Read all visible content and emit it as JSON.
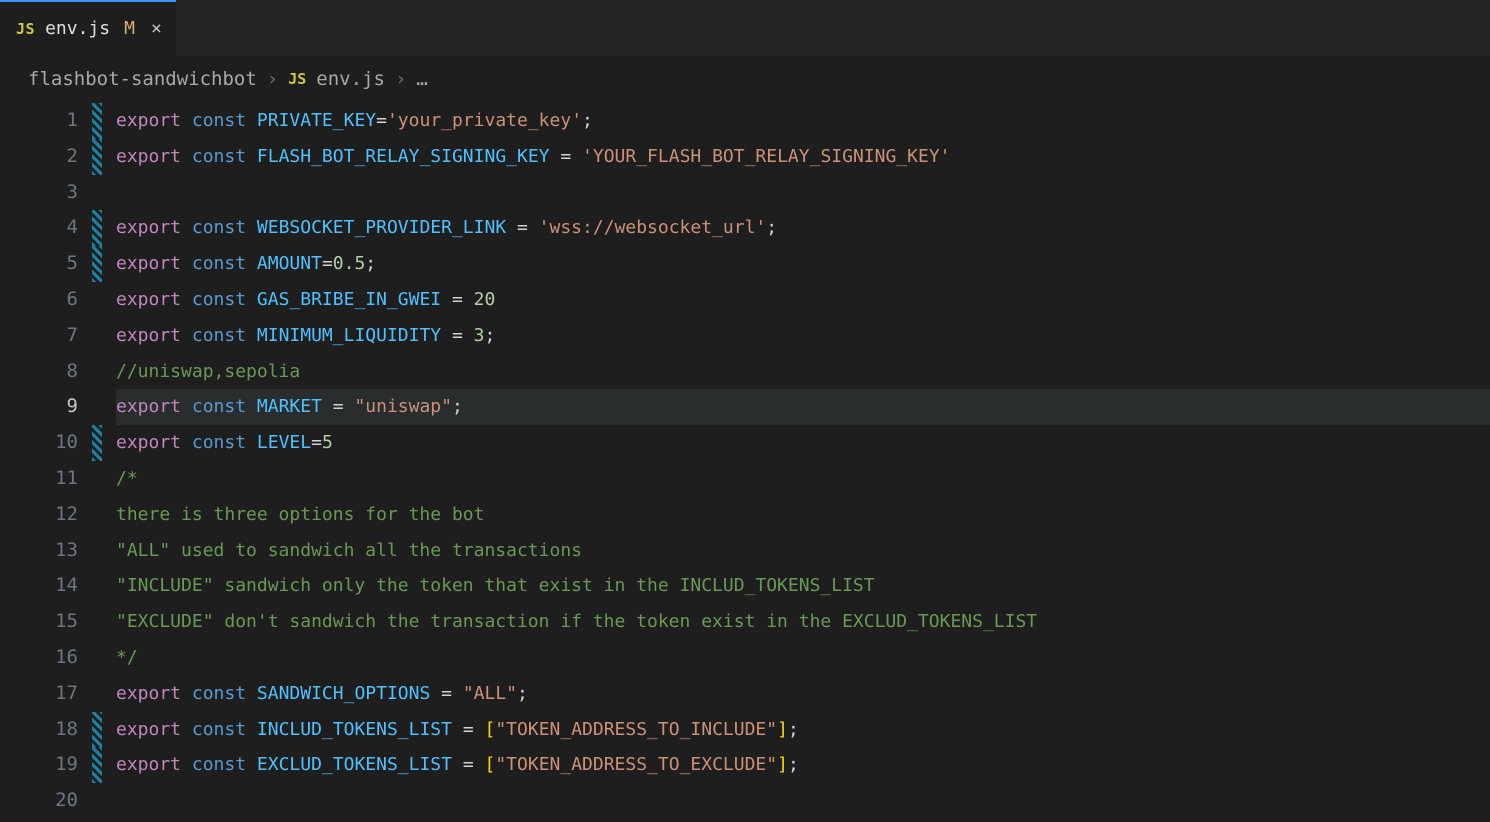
{
  "tab": {
    "icon_label": "JS",
    "filename": "env.js",
    "modified_marker": "M",
    "close_glyph": "×"
  },
  "breadcrumbs": {
    "folder": "flashbot-sandwichbot",
    "icon_label": "JS",
    "file": "env.js",
    "rest": "…"
  },
  "editor": {
    "current_line": 9,
    "lines": [
      {
        "n": 1,
        "modified": true,
        "tokens": [
          [
            "kw",
            "export"
          ],
          [
            "pn",
            " "
          ],
          [
            "dec",
            "const"
          ],
          [
            "pn",
            " "
          ],
          [
            "id",
            "PRIVATE_KEY"
          ],
          [
            "pn",
            "="
          ],
          [
            "str",
            "'your_private_key'"
          ],
          [
            "pn",
            ";"
          ]
        ]
      },
      {
        "n": 2,
        "modified": true,
        "tokens": [
          [
            "kw",
            "export"
          ],
          [
            "pn",
            " "
          ],
          [
            "dec",
            "const"
          ],
          [
            "pn",
            " "
          ],
          [
            "id",
            "FLASH_BOT_RELAY_SIGNING_KEY"
          ],
          [
            "pn",
            " = "
          ],
          [
            "str",
            "'YOUR_FLASH_BOT_RELAY_SIGNING_KEY'"
          ]
        ]
      },
      {
        "n": 3,
        "modified": false,
        "tokens": [
          [
            "pn",
            ""
          ]
        ]
      },
      {
        "n": 4,
        "modified": true,
        "tokens": [
          [
            "kw",
            "export"
          ],
          [
            "pn",
            " "
          ],
          [
            "dec",
            "const"
          ],
          [
            "pn",
            " "
          ],
          [
            "id",
            "WEBSOCKET_PROVIDER_LINK"
          ],
          [
            "pn",
            " = "
          ],
          [
            "str",
            "'wss://websocket_url'"
          ],
          [
            "pn",
            ";"
          ]
        ]
      },
      {
        "n": 5,
        "modified": true,
        "tokens": [
          [
            "kw",
            "export"
          ],
          [
            "pn",
            " "
          ],
          [
            "dec",
            "const"
          ],
          [
            "pn",
            " "
          ],
          [
            "id",
            "AMOUNT"
          ],
          [
            "pn",
            "="
          ],
          [
            "num",
            "0.5"
          ],
          [
            "pn",
            ";"
          ]
        ]
      },
      {
        "n": 6,
        "modified": false,
        "tokens": [
          [
            "kw",
            "export"
          ],
          [
            "pn",
            " "
          ],
          [
            "dec",
            "const"
          ],
          [
            "pn",
            " "
          ],
          [
            "id",
            "GAS_BRIBE_IN_GWEI"
          ],
          [
            "pn",
            " = "
          ],
          [
            "num",
            "20"
          ]
        ]
      },
      {
        "n": 7,
        "modified": false,
        "tokens": [
          [
            "kw",
            "export"
          ],
          [
            "pn",
            " "
          ],
          [
            "dec",
            "const"
          ],
          [
            "pn",
            " "
          ],
          [
            "id",
            "MINIMUM_LIQUIDITY"
          ],
          [
            "pn",
            " = "
          ],
          [
            "num",
            "3"
          ],
          [
            "pn",
            ";"
          ]
        ]
      },
      {
        "n": 8,
        "modified": false,
        "tokens": [
          [
            "cmt",
            "//uniswap,sepolia"
          ]
        ]
      },
      {
        "n": 9,
        "modified": false,
        "tokens": [
          [
            "kw",
            "export"
          ],
          [
            "pn",
            " "
          ],
          [
            "dec",
            "const"
          ],
          [
            "pn",
            " "
          ],
          [
            "id",
            "MARKET"
          ],
          [
            "pn",
            " = "
          ],
          [
            "str",
            "\"uniswap\""
          ],
          [
            "pn",
            ";"
          ]
        ]
      },
      {
        "n": 10,
        "modified": true,
        "tokens": [
          [
            "kw",
            "export"
          ],
          [
            "pn",
            " "
          ],
          [
            "dec",
            "const"
          ],
          [
            "pn",
            " "
          ],
          [
            "id",
            "LEVEL"
          ],
          [
            "pn",
            "="
          ],
          [
            "num",
            "5"
          ]
        ]
      },
      {
        "n": 11,
        "modified": false,
        "tokens": [
          [
            "cmt",
            "/*"
          ]
        ]
      },
      {
        "n": 12,
        "modified": false,
        "tokens": [
          [
            "cmt",
            "there is three options for the bot"
          ]
        ]
      },
      {
        "n": 13,
        "modified": false,
        "tokens": [
          [
            "cmt",
            "\"ALL\" used to sandwich all the transactions"
          ]
        ]
      },
      {
        "n": 14,
        "modified": false,
        "tokens": [
          [
            "cmt",
            "\"INCLUDE\" sandwich only the token that exist in the INCLUD_TOKENS_LIST"
          ]
        ]
      },
      {
        "n": 15,
        "modified": false,
        "tokens": [
          [
            "cmt",
            "\"EXCLUDE\" don't sandwich the transaction if the token exist in the EXCLUD_TOKENS_LIST"
          ]
        ]
      },
      {
        "n": 16,
        "modified": false,
        "tokens": [
          [
            "cmt",
            "*/"
          ]
        ]
      },
      {
        "n": 17,
        "modified": false,
        "tokens": [
          [
            "kw",
            "export"
          ],
          [
            "pn",
            " "
          ],
          [
            "dec",
            "const"
          ],
          [
            "pn",
            " "
          ],
          [
            "id",
            "SANDWICH_OPTIONS"
          ],
          [
            "pn",
            " = "
          ],
          [
            "str",
            "\"ALL\""
          ],
          [
            "pn",
            ";"
          ]
        ]
      },
      {
        "n": 18,
        "modified": true,
        "tokens": [
          [
            "kw",
            "export"
          ],
          [
            "pn",
            " "
          ],
          [
            "dec",
            "const"
          ],
          [
            "pn",
            " "
          ],
          [
            "id",
            "INCLUD_TOKENS_LIST"
          ],
          [
            "pn",
            " = "
          ],
          [
            "br",
            "["
          ],
          [
            "str",
            "\"TOKEN_ADDRESS_TO_INCLUDE\""
          ],
          [
            "br",
            "]"
          ],
          [
            "pn",
            ";"
          ]
        ]
      },
      {
        "n": 19,
        "modified": true,
        "tokens": [
          [
            "kw",
            "export"
          ],
          [
            "pn",
            " "
          ],
          [
            "dec",
            "const"
          ],
          [
            "pn",
            " "
          ],
          [
            "id",
            "EXCLUD_TOKENS_LIST"
          ],
          [
            "pn",
            " = "
          ],
          [
            "br",
            "["
          ],
          [
            "str",
            "\"TOKEN_ADDRESS_TO_EXCLUDE\""
          ],
          [
            "br",
            "]"
          ],
          [
            "pn",
            ";"
          ]
        ]
      },
      {
        "n": 20,
        "modified": false,
        "tokens": [
          [
            "pn",
            ""
          ]
        ]
      }
    ]
  }
}
